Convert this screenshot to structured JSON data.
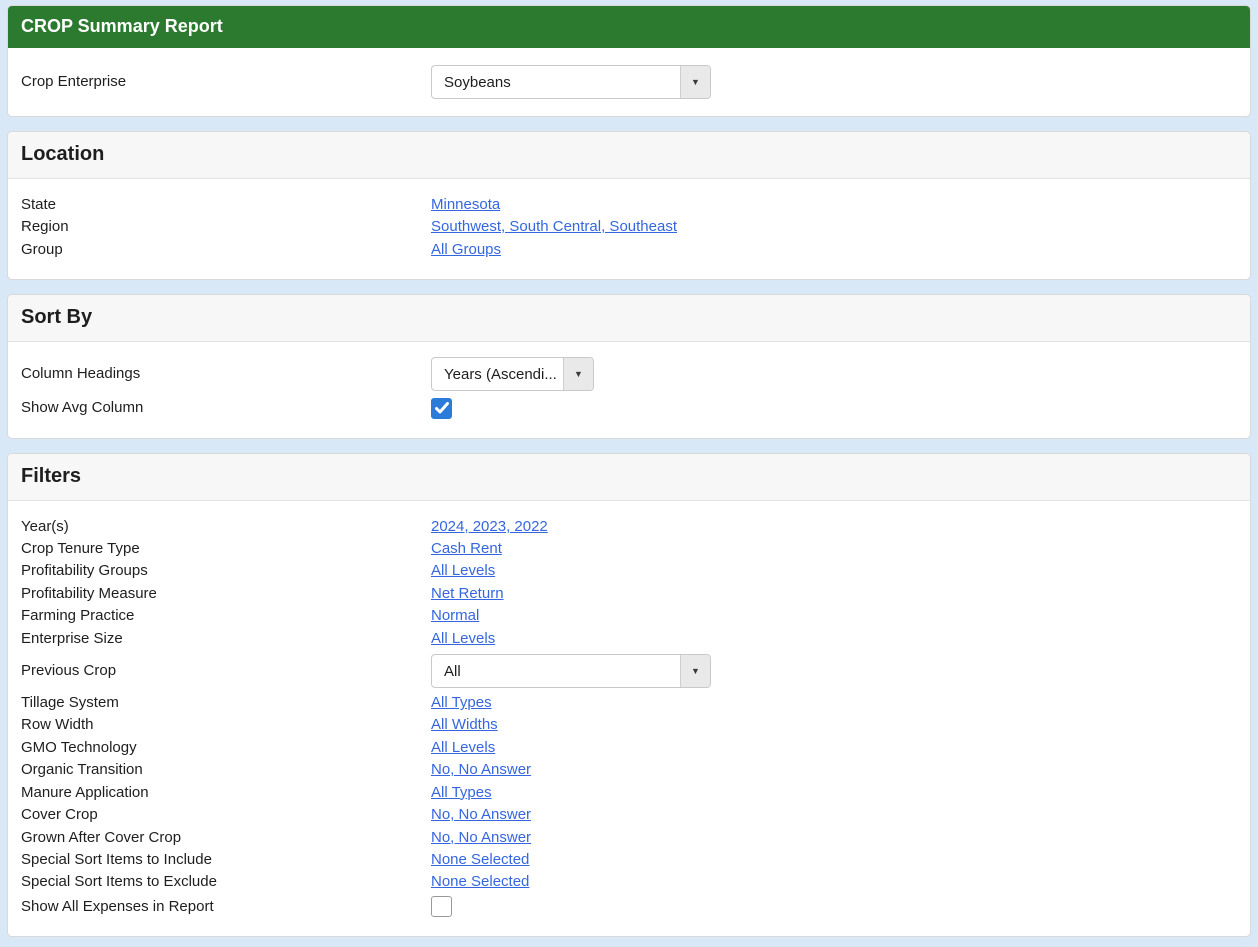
{
  "colors": {
    "page_background": "#d8e8f6",
    "brand_green": "#2b7a2f",
    "link_blue": "#3566e0",
    "checkbox_blue": "#2b7cd9"
  },
  "report": {
    "title": "CROP Summary Report"
  },
  "crop_enterprise": {
    "label": "Crop Enterprise",
    "value": "Soybeans"
  },
  "location": {
    "title": "Location",
    "rows": [
      {
        "label": "State",
        "value": "Minnesota"
      },
      {
        "label": "Region",
        "value": "Southwest, South Central, Southeast"
      },
      {
        "label": "Group",
        "value": "All Groups"
      }
    ]
  },
  "sort_by": {
    "title": "Sort By",
    "column_headings_label": "Column Headings",
    "column_headings_value": "Years (Ascendi...",
    "show_avg_label": "Show Avg Column",
    "show_avg_checked": true
  },
  "filters": {
    "title": "Filters",
    "top_rows": [
      {
        "label": "Year(s)",
        "value": "2024, 2023, 2022"
      },
      {
        "label": "Crop Tenure Type",
        "value": "Cash Rent"
      },
      {
        "label": "Profitability Groups",
        "value": "All Levels"
      },
      {
        "label": "Profitability Measure",
        "value": "Net Return"
      },
      {
        "label": "Farming Practice",
        "value": "Normal"
      },
      {
        "label": "Enterprise Size",
        "value": "All Levels"
      }
    ],
    "previous_crop": {
      "label": "Previous Crop",
      "value": "All"
    },
    "bottom_rows": [
      {
        "label": "Tillage System",
        "value": "All Types"
      },
      {
        "label": "Row Width",
        "value": "All Widths"
      },
      {
        "label": "GMO Technology",
        "value": "All Levels"
      },
      {
        "label": "Organic Transition",
        "value": "No, No Answer"
      },
      {
        "label": "Manure Application",
        "value": "All Types"
      },
      {
        "label": "Cover Crop",
        "value": "No, No Answer"
      },
      {
        "label": "Grown After Cover Crop",
        "value": "No, No Answer"
      },
      {
        "label": "Special Sort Items to Include",
        "value": "None Selected"
      },
      {
        "label": "Special Sort Items to Exclude",
        "value": "None Selected"
      }
    ],
    "show_all_expenses_label": "Show All Expenses in Report",
    "show_all_expenses_checked": false
  },
  "icons": {
    "dropdown_caret": "▼"
  }
}
